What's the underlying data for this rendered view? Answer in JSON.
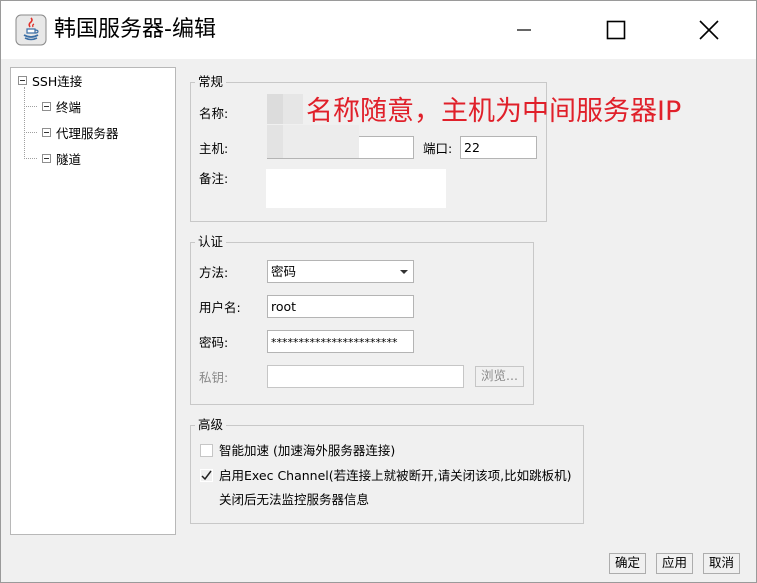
{
  "window": {
    "title": "韩国服务器-编辑",
    "controls": {
      "minimize_icon": "minimize-icon",
      "maximize_icon": "maximize-icon",
      "close_icon": "close-icon"
    }
  },
  "tree": {
    "root": "SSH连接",
    "children": [
      "终端",
      "代理服务器",
      "隧道"
    ]
  },
  "general": {
    "legend": "常规",
    "name_label": "名称:",
    "name_value": "",
    "host_label": "主机:",
    "host_value": "",
    "port_label": "端口:",
    "port_value": "22",
    "note_label": "备注:",
    "note_value": ""
  },
  "annotation": "名称随意，主机为中间服务器IP",
  "auth": {
    "legend": "认证",
    "method_label": "方法:",
    "method_value": "密码",
    "username_label": "用户名:",
    "username_value": "root",
    "password_label": "密码:",
    "password_value": "***********************",
    "key_label": "私钥:",
    "key_value": "",
    "browse_label": "浏览..."
  },
  "advanced": {
    "legend": "高级",
    "smart_accel_label": "智能加速 (加速海外服务器连接)",
    "smart_accel_checked": false,
    "exec_channel_label": "启用Exec Channel(若连接上就被断开,请关闭该项,比如跳板机)",
    "exec_channel_checked": true,
    "exec_channel_note": "关闭后无法监控服务器信息"
  },
  "footer": {
    "ok_label": "确定",
    "apply_label": "应用",
    "cancel_label": "取消"
  },
  "colors": {
    "annotation": "#e0202a",
    "window_bg": "#f0f0f0"
  }
}
